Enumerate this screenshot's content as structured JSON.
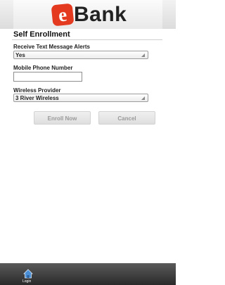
{
  "header": {
    "logo_letter": "e",
    "logo_text": "Bank"
  },
  "page": {
    "title": "Self Enrollment"
  },
  "form": {
    "text_alerts": {
      "label": "Receive Text Message Alerts",
      "value": "Yes"
    },
    "mobile_phone": {
      "label": "Mobile Phone Number",
      "value": ""
    },
    "wireless_provider": {
      "label": "Wireless Provider",
      "value": "3 River Wireless"
    }
  },
  "buttons": {
    "enroll": "Enroll Now",
    "cancel": "Cancel"
  },
  "footer": {
    "login_label": "Login"
  },
  "colors": {
    "brand_red": "#e43a20",
    "footer_dark": "#2a2a2a",
    "icon_blue": "#4a8ed6"
  }
}
